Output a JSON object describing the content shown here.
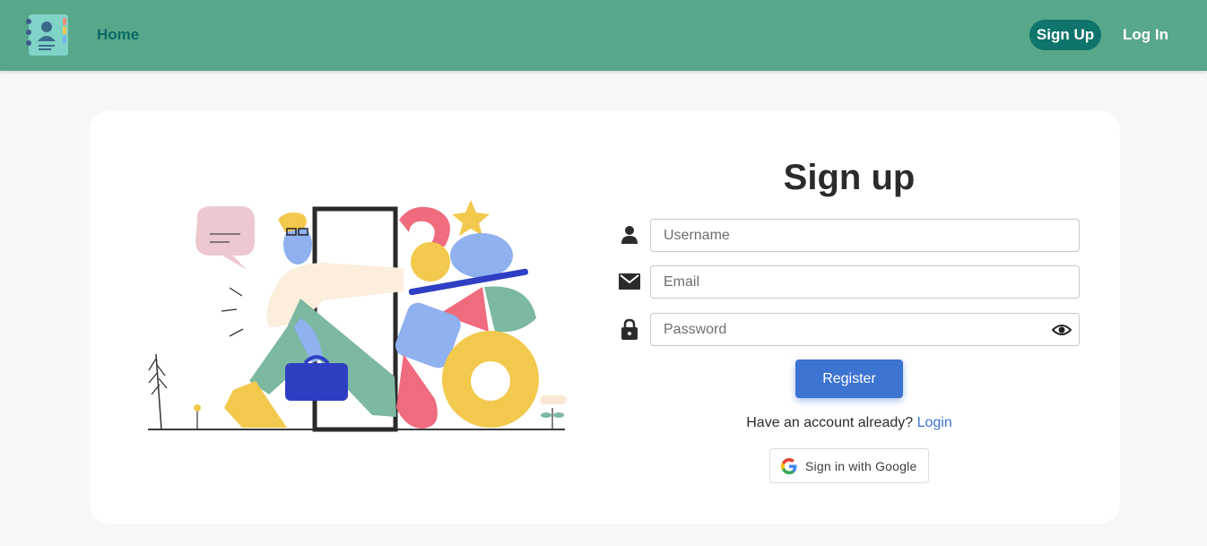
{
  "nav": {
    "logo_icon": "address-book-icon",
    "home_label": "Home",
    "signup_label": "Sign Up",
    "login_label": "Log In"
  },
  "form": {
    "title": "Sign up",
    "username": {
      "icon": "user-icon",
      "placeholder": "Username",
      "value": ""
    },
    "email": {
      "icon": "envelope-icon",
      "placeholder": "Email",
      "value": ""
    },
    "password": {
      "icon": "lock-icon",
      "placeholder": "Password",
      "value": "",
      "toggle_icon": "eye-icon"
    },
    "register_label": "Register",
    "have_account_text": "Have an account already?",
    "login_link": "Login",
    "google_label": "Sign in with Google"
  },
  "colors": {
    "navbar": "#57a78a",
    "accent_teal": "#0e746c",
    "primary_blue": "#3d73d1"
  }
}
